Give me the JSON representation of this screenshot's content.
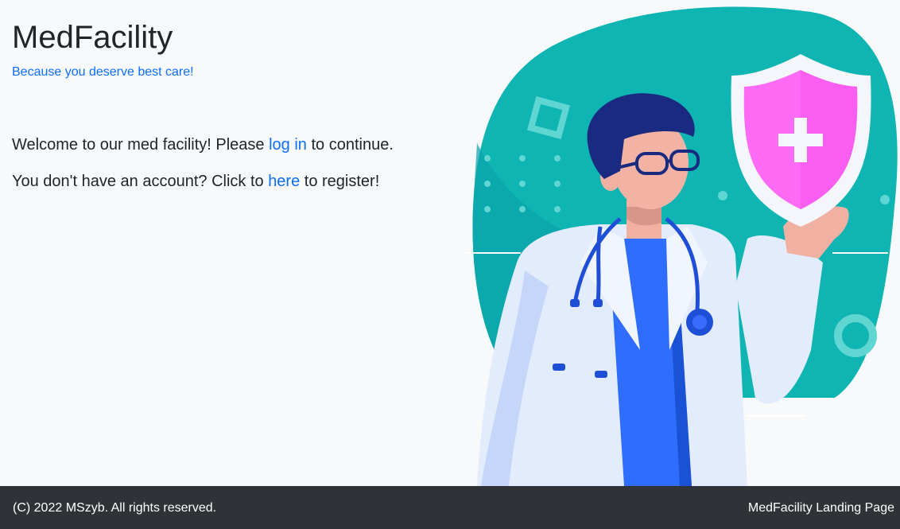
{
  "brand": {
    "title": "MedFacility",
    "tagline": "Because you deserve best care!"
  },
  "welcome": {
    "login_prefix": "Welcome to our med facility! Please ",
    "login_link": "log in",
    "login_suffix": " to continue.",
    "register_prefix": "You don't have an account? Click to ",
    "register_link": "here",
    "register_suffix": " to register!"
  },
  "illustration": {
    "icon": "doctor-with-shield-illustration"
  },
  "footer": {
    "copyright": "(C) 2022 MSzyb. All rights reserved.",
    "page_label": "MedFacility Landing Page"
  },
  "colors": {
    "background": "#f8f9fa",
    "link": "#0d6efd",
    "footer_bg": "#2f3337",
    "teal": "#0fb5b3",
    "shield_pink": "#ff6bf5"
  }
}
